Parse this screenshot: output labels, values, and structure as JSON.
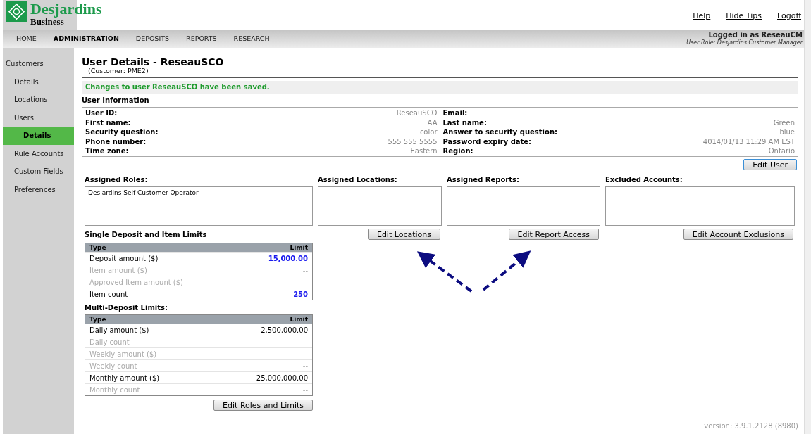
{
  "brand": {
    "name": "Desjardins",
    "subtitle": "Business"
  },
  "top_links": [
    "Help",
    "Hide Tips",
    "Logoff"
  ],
  "nav": [
    {
      "label": "HOME",
      "selected": false
    },
    {
      "label": "ADMINISTRATION",
      "selected": true
    },
    {
      "label": "DEPOSITS",
      "selected": false
    },
    {
      "label": "REPORTS",
      "selected": false
    },
    {
      "label": "RESEARCH",
      "selected": false
    }
  ],
  "session": {
    "logged_in": "Logged in as ReseauCM",
    "role": "User Role: Desjardins Customer Manager"
  },
  "sidebar": [
    {
      "label": "Customers",
      "selected": false,
      "children": [
        {
          "label": "Details",
          "selected": false
        },
        {
          "label": "Locations",
          "selected": false
        },
        {
          "label": "Users",
          "selected": false,
          "children": [
            {
              "label": "Details",
              "selected": true
            }
          ]
        },
        {
          "label": "Rule Accounts",
          "selected": false
        },
        {
          "label": "Custom Fields",
          "selected": false
        },
        {
          "label": "Preferences",
          "selected": false
        }
      ]
    }
  ],
  "page": {
    "title": "User Details - ReseauSCO",
    "subtitle": "(Customer: PME2)"
  },
  "message": "Changes to user ReseauSCO have been saved.",
  "user_info": {
    "title": "User Information",
    "left": [
      {
        "label": "User ID:",
        "value": "ReseauSCO"
      },
      {
        "label": "First name:",
        "value": "AA"
      },
      {
        "label": "Security question:",
        "value": "color"
      },
      {
        "label": "Phone number:",
        "value": "555 555 5555"
      },
      {
        "label": "Time zone:",
        "value": "Eastern"
      }
    ],
    "right": [
      {
        "label": "Email:"
      },
      {
        "label": "Last name:",
        "value": "Green"
      },
      {
        "label": "Answer to security question:",
        "value": "blue"
      },
      {
        "label": "Password expiry date:",
        "value": "4014/01/13 11:29 AM EST"
      },
      {
        "label": "Region:",
        "value": "Ontario"
      }
    ],
    "button": "Edit User"
  },
  "assigned": [
    {
      "title": "Assigned Roles:",
      "items": [
        "Desjardins Self Customer Operator"
      ]
    },
    {
      "title": "Assigned Locations:",
      "button": "Edit Locations"
    },
    {
      "title": "Assigned Reports:",
      "button": "Edit Report Access"
    },
    {
      "title": "Excluded Accounts:",
      "button": "Edit Account Exclusions"
    }
  ],
  "single_limits": {
    "title": "Single Deposit and Item Limits",
    "columns": [
      "Type",
      "Limit"
    ],
    "rows": [
      {
        "type": "Deposit amount ($)",
        "limit": "15,000.00",
        "disabled": false,
        "highlighted": true
      },
      {
        "type": "Item amount ($)",
        "limit": "--",
        "disabled": true,
        "highlighted": false
      },
      {
        "type": "Approved Item amount ($)",
        "limit": "--",
        "disabled": true,
        "highlighted": false
      },
      {
        "type": "Item count",
        "limit": "250",
        "disabled": false,
        "highlighted": true
      }
    ]
  },
  "multi_limits": {
    "title": "Multi-Deposit Limits:",
    "columns": [
      "Type",
      "Limit"
    ],
    "rows": [
      {
        "type": "Daily amount ($)",
        "limit": "2,500,000.00",
        "disabled": false,
        "highlighted": false
      },
      {
        "type": "Daily count",
        "limit": "--",
        "disabled": true,
        "highlighted": false
      },
      {
        "type": "Weekly amount ($)",
        "limit": "--",
        "disabled": true,
        "highlighted": false
      },
      {
        "type": "Weekly count",
        "limit": "--",
        "disabled": true,
        "highlighted": false
      },
      {
        "type": "Monthly amount ($)",
        "limit": "25,000,000.00",
        "disabled": false,
        "highlighted": false
      },
      {
        "type": "Monthly count",
        "limit": "--",
        "disabled": true,
        "highlighted": false
      }
    ]
  },
  "limits_button": "Edit Roles and Limits",
  "version": "version: 3.9.1.2128 (8980)"
}
